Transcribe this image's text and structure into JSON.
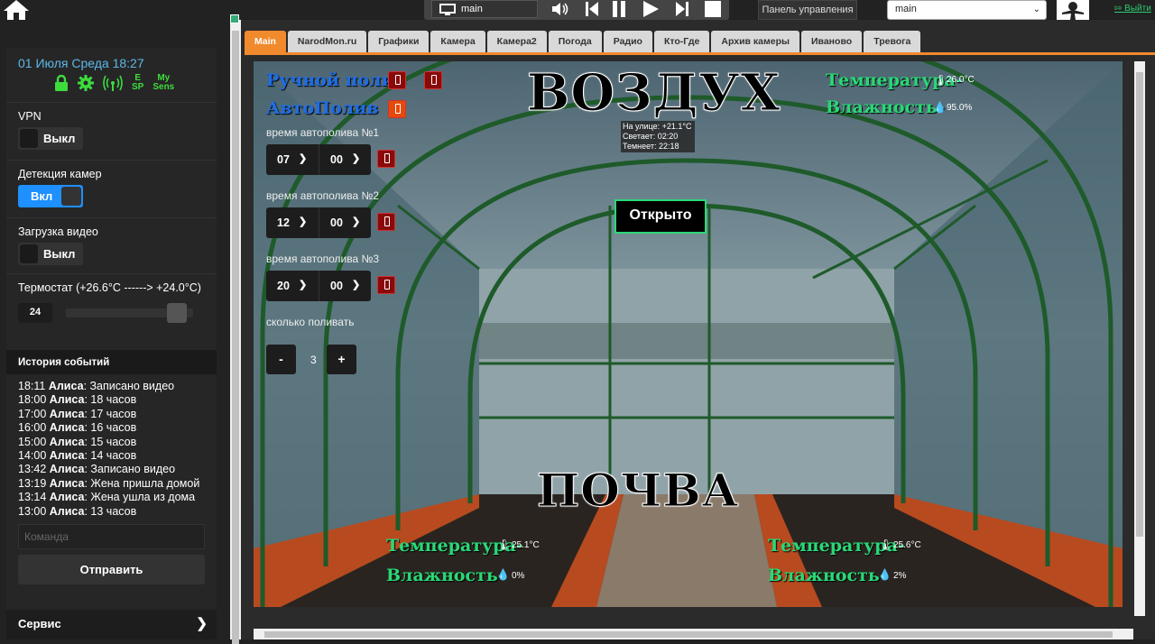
{
  "player": {
    "screen": "main"
  },
  "header": {
    "panel_label": "Панель управления",
    "select_value": "main",
    "logout": "Выйти"
  },
  "sidebar": {
    "date": "01 Июля Среда   18:27",
    "status": {
      "e": "E",
      "sp": "SP",
      "my": "My",
      "sens": "Sens"
    },
    "vpn": {
      "label": "VPN",
      "state": "Выкл"
    },
    "camera_detect": {
      "label": "Детекция камер",
      "state": "Вкл"
    },
    "video_upload": {
      "label": "Загрузка видео",
      "state": "Выкл"
    },
    "thermostat": {
      "label": "Термостат (+26.6°C ------> +24.0°C)",
      "value": "24",
      "level_percent": 87
    },
    "history_title": "История событий",
    "history": [
      {
        "time": "18:11",
        "who": "Алиса",
        "text": ": Записано видео"
      },
      {
        "time": "18:00",
        "who": "Алиса",
        "text": ": 18 часов"
      },
      {
        "time": "17:00",
        "who": "Алиса",
        "text": ": 17 часов"
      },
      {
        "time": "16:00",
        "who": "Алиса",
        "text": ": 16 часов"
      },
      {
        "time": "15:00",
        "who": "Алиса",
        "text": ": 15 часов"
      },
      {
        "time": "14:00",
        "who": "Алиса",
        "text": ": 14 часов"
      },
      {
        "time": "13:42",
        "who": "Алиса",
        "text": ": Записано видео"
      },
      {
        "time": "13:19",
        "who": "Алиса",
        "text": ": Жена пришла домой"
      },
      {
        "time": "13:14",
        "who": "Алиса",
        "text": ": Жена ушла из дома"
      },
      {
        "time": "13:00",
        "who": "Алиса",
        "text": ": 13 часов"
      }
    ],
    "command_placeholder": "Команда",
    "send_label": "Отправить",
    "service_label": "Сервис"
  },
  "tabs": [
    "Main",
    "NarodMon.ru",
    "Графики",
    "Камера",
    "Камера2",
    "Погода",
    "Радио",
    "Кто-Где",
    "Архив камеры",
    "Иваново",
    "Тревога"
  ],
  "scene": {
    "air_title": "ВОЗДУХ",
    "soil_title": "ПОЧВА",
    "manual_watering": "Ручной полив",
    "auto_watering": "АвтоПолив",
    "air_temp_label": "Температура-",
    "air_temp_value": "26.0°C",
    "air_hum_label": "Влажность-",
    "air_hum_value": "95.0%",
    "street": {
      "l1": "На улице: +21.1°C",
      "l2": "Светает: 02:20",
      "l3": "Темнеет: 22:18"
    },
    "door_status": "Открыто",
    "auto_times": [
      {
        "label": "время автополива №1",
        "hour": "07",
        "minute": "00"
      },
      {
        "label": "время автополива №2",
        "hour": "12",
        "minute": "00"
      },
      {
        "label": "время автополива №3",
        "hour": "20",
        "minute": "00"
      }
    ],
    "how_much_label": "сколько поливать",
    "minus": "-",
    "plus": "+",
    "amount": "3",
    "soil_left": {
      "temp_label": "Температура-",
      "temp_value": "25.1°C",
      "hum_label": "Влажность-",
      "hum_value": "0%"
    },
    "soil_right": {
      "temp_label": "Температура-",
      "temp_value": "25.6°C",
      "hum_label": "Влажность-",
      "hum_value": "2%"
    }
  },
  "colors": {
    "accent": "#f08a2c",
    "green": "#2ad877",
    "blue": "#1e6de6",
    "toggle_on": "#1e90ff",
    "date": "#5db8e8"
  }
}
